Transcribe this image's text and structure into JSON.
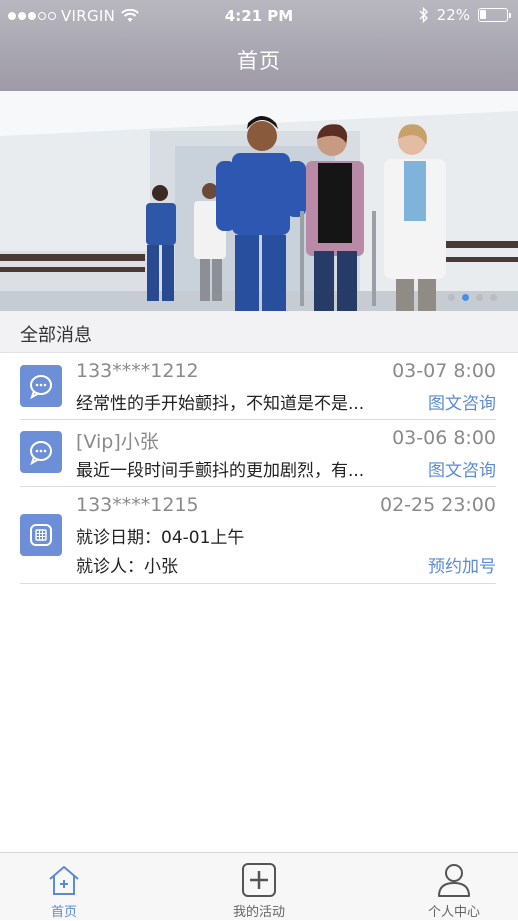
{
  "status_bar": {
    "carrier": "VIRGIN",
    "time": "4:21 PM",
    "battery": "22%",
    "battery_level": 0.22,
    "signal_bars_filled": 3,
    "signal_bars_total": 5,
    "icons": [
      "wifi-icon",
      "bluetooth-icon",
      "battery-icon"
    ]
  },
  "nav": {
    "title": "首页"
  },
  "banner": {
    "description_icon": "hospital-banner-image",
    "pager_count": 4,
    "pager_active_index": 1
  },
  "section": {
    "title": "全部消息"
  },
  "messages": [
    {
      "icon": "chat-bubble-icon",
      "title": "133****1212",
      "time": "03-07 8:00",
      "body": "经常性的手开始颤抖，不知道是不是...",
      "action": "图文咨询"
    },
    {
      "icon": "chat-bubble-icon",
      "title": "[Vip]小张",
      "time": "03-06 8:00",
      "body": "最近一段时间手颤抖的更加剧烈，有...",
      "action": "图文咨询"
    },
    {
      "icon": "calendar-icon",
      "title": "133****1215",
      "time": "02-25 23:00",
      "body": "就诊日期：04-01上午",
      "body2": "就诊人：小张",
      "action": "预约加号"
    }
  ],
  "tabbar": {
    "tabs": [
      {
        "label": "首页",
        "icon": "home-icon",
        "active": true
      },
      {
        "label": "我的活动",
        "icon": "add-square-icon",
        "active": false
      },
      {
        "label": "个人中心",
        "icon": "person-icon",
        "active": false
      }
    ]
  },
  "colors": {
    "accent": "#5b8ad6",
    "avatar_bg": "#6c8fd8",
    "header_bg": "#a9a7b1"
  }
}
